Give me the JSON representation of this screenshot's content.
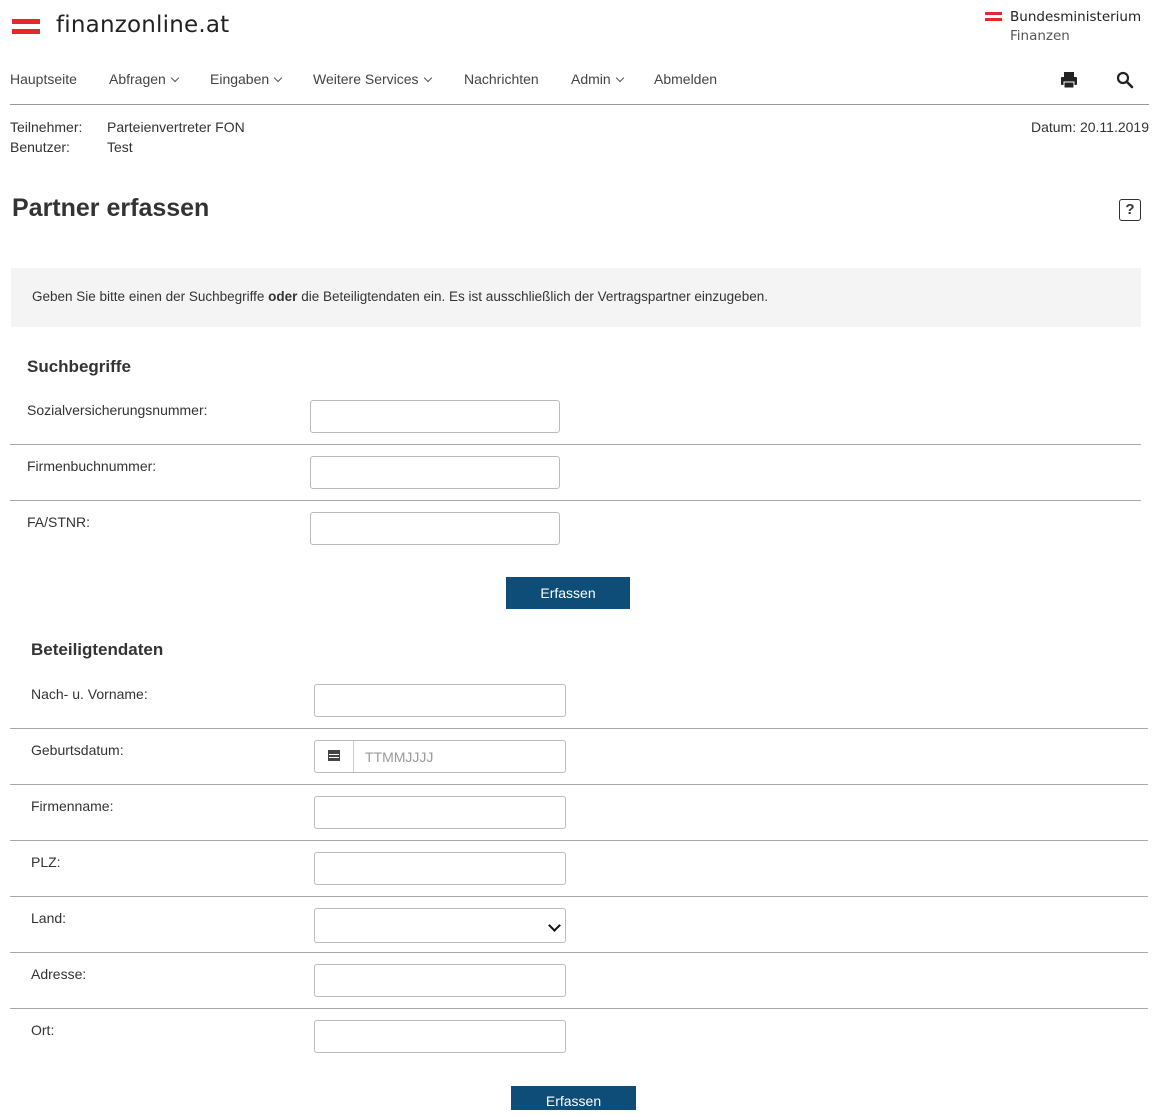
{
  "header": {
    "logo_text": "finanzonline.at",
    "ministry_line1": "Bundesministerium",
    "ministry_line2": "Finanzen"
  },
  "nav": {
    "items": [
      {
        "label": "Hauptseite"
      },
      {
        "label": "Abfragen"
      },
      {
        "label": "Eingaben"
      },
      {
        "label": "Weitere Services"
      },
      {
        "label": "Nachrichten"
      },
      {
        "label": "Admin"
      },
      {
        "label": "Abmelden"
      }
    ],
    "icons": [
      "print-icon",
      "search-icon"
    ]
  },
  "info": {
    "teilnehmer_label": "Teilnehmer:",
    "teilnehmer_value": "Parteienvertreter FON",
    "benutzer_label": "Benutzer:",
    "benutzer_value": "Test",
    "datum": "Datum: 20.11.2019"
  },
  "page": {
    "title": "Partner erfassen",
    "help": "?",
    "notice_pre": "Geben Sie bitte einen der Suchbegriffe ",
    "notice_bold": "oder",
    "notice_post": " die Beteiligtendaten ein. Es ist ausschließlich der Vertragspartner einzugeben."
  },
  "suchbegriffe": {
    "heading": "Suchbegriffe",
    "fields": [
      {
        "label": "Sozialversicherungsnummer:",
        "value": ""
      },
      {
        "label": "Firmenbuchnummer:",
        "value": ""
      },
      {
        "label": "FA/STNR:",
        "value": ""
      }
    ],
    "button": "Erfassen"
  },
  "beteiligtendaten": {
    "heading": "Beteiligtendaten",
    "fields": [
      {
        "label": "Nach- u. Vorname:",
        "value": ""
      },
      {
        "label": "Geburtsdatum:",
        "value": "",
        "placeholder": "TTMMJJJJ"
      },
      {
        "label": "Firmenname:",
        "value": ""
      },
      {
        "label": "PLZ:",
        "value": ""
      },
      {
        "label": "Land:",
        "value": ""
      },
      {
        "label": "Adresse:",
        "value": ""
      },
      {
        "label": "Ort:",
        "value": ""
      }
    ],
    "button": "Erfassen"
  }
}
